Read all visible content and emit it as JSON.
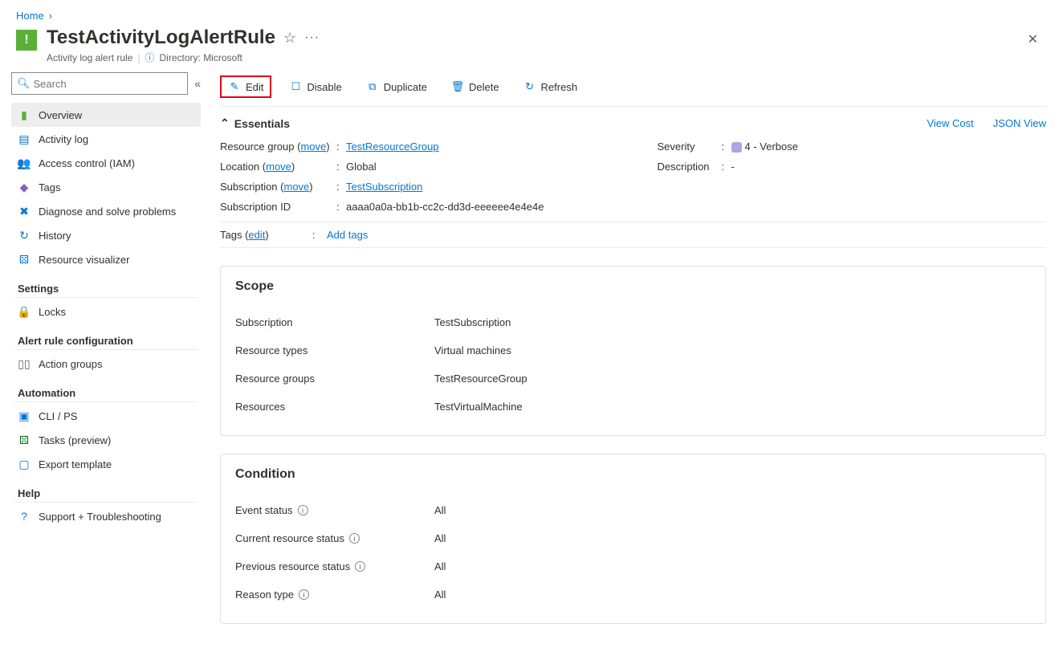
{
  "breadcrumb": {
    "home": "Home"
  },
  "header": {
    "title": "TestActivityLogAlertRule",
    "subtitle": "Activity log alert rule",
    "directory_label": "Directory: Microsoft"
  },
  "search": {
    "placeholder": "Search"
  },
  "sidebar": {
    "items": [
      {
        "label": "Overview"
      },
      {
        "label": "Activity log"
      },
      {
        "label": "Access control (IAM)"
      },
      {
        "label": "Tags"
      },
      {
        "label": "Diagnose and solve problems"
      },
      {
        "label": "History"
      },
      {
        "label": "Resource visualizer"
      }
    ],
    "sections": {
      "settings": {
        "title": "Settings",
        "items": [
          {
            "label": "Locks"
          }
        ]
      },
      "alert_rule": {
        "title": "Alert rule configuration",
        "items": [
          {
            "label": "Action groups"
          }
        ]
      },
      "automation": {
        "title": "Automation",
        "items": [
          {
            "label": "CLI / PS"
          },
          {
            "label": "Tasks (preview)"
          },
          {
            "label": "Export template"
          }
        ]
      },
      "help": {
        "title": "Help",
        "items": [
          {
            "label": "Support + Troubleshooting"
          }
        ]
      }
    }
  },
  "toolbar": {
    "edit": "Edit",
    "disable": "Disable",
    "duplicate": "Duplicate",
    "delete": "Delete",
    "refresh": "Refresh"
  },
  "essentials": {
    "heading": "Essentials",
    "view_cost": "View Cost",
    "json_view": "JSON View",
    "move": "move",
    "left": {
      "resource_group_label": "Resource group",
      "resource_group_value": "TestResourceGroup",
      "location_label": "Location",
      "location_value": "Global",
      "subscription_label": "Subscription",
      "subscription_value": "TestSubscription",
      "subscription_id_label": "Subscription ID",
      "subscription_id_value": "aaaa0a0a-bb1b-cc2c-dd3d-eeeeee4e4e4e"
    },
    "right": {
      "severity_label": "Severity",
      "severity_value": "4 - Verbose",
      "description_label": "Description",
      "description_value": "-"
    },
    "tags_label": "Tags",
    "tags_edit": "edit",
    "tags_add": "Add tags"
  },
  "scope": {
    "heading": "Scope",
    "subscription_label": "Subscription",
    "subscription_value": "TestSubscription",
    "resource_types_label": "Resource types",
    "resource_types_value": "Virtual machines",
    "resource_groups_label": "Resource groups",
    "resource_groups_value": "TestResourceGroup",
    "resources_label": "Resources",
    "resources_value": "TestVirtualMachine"
  },
  "condition": {
    "heading": "Condition",
    "event_status_label": "Event status",
    "event_status_value": "All",
    "current_status_label": "Current resource status",
    "current_status_value": "All",
    "previous_status_label": "Previous resource status",
    "previous_status_value": "All",
    "reason_type_label": "Reason type",
    "reason_type_value": "All"
  }
}
